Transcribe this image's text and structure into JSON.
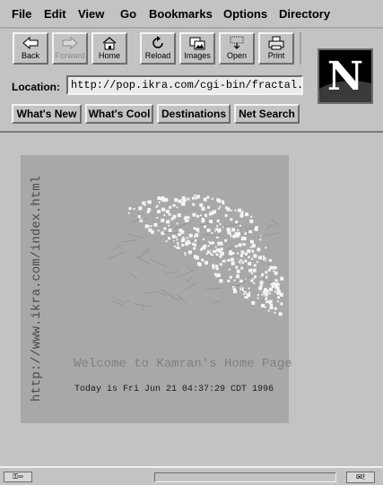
{
  "menu": [
    "File",
    "Edit",
    "View",
    "Go",
    "Bookmarks",
    "Options",
    "Directory"
  ],
  "toolbar": [
    {
      "label": "Back",
      "icon": "back-arrow-icon",
      "enabled": true
    },
    {
      "label": "Forward",
      "icon": "forward-arrow-icon",
      "enabled": false
    },
    {
      "label": "Home",
      "icon": "home-icon",
      "enabled": true
    },
    {
      "label": "Reload",
      "icon": "reload-icon",
      "enabled": true
    },
    {
      "label": "Images",
      "icon": "images-icon",
      "enabled": true
    },
    {
      "label": "Open",
      "icon": "open-icon",
      "enabled": true
    },
    {
      "label": "Print",
      "icon": "print-icon",
      "enabled": true
    }
  ],
  "location": {
    "label": "Location:",
    "value": "http://pop.ikra.com/cgi-bin/fractal.cg"
  },
  "directory_buttons": [
    "What's New",
    "What's Cool",
    "Destinations",
    "Net Search"
  ],
  "brand": {
    "letter": "N"
  },
  "page": {
    "side_url": "http://www.ikra.com/index.html",
    "welcome": "Welcome to Kamran's Home Page",
    "today": "Today is Fri Jun 21 04:37:29 CDT 1996"
  },
  "colors": {
    "background": "#c3c3c3",
    "image_bg": "#a8a8a8",
    "fractal": "#f4f4f4"
  }
}
